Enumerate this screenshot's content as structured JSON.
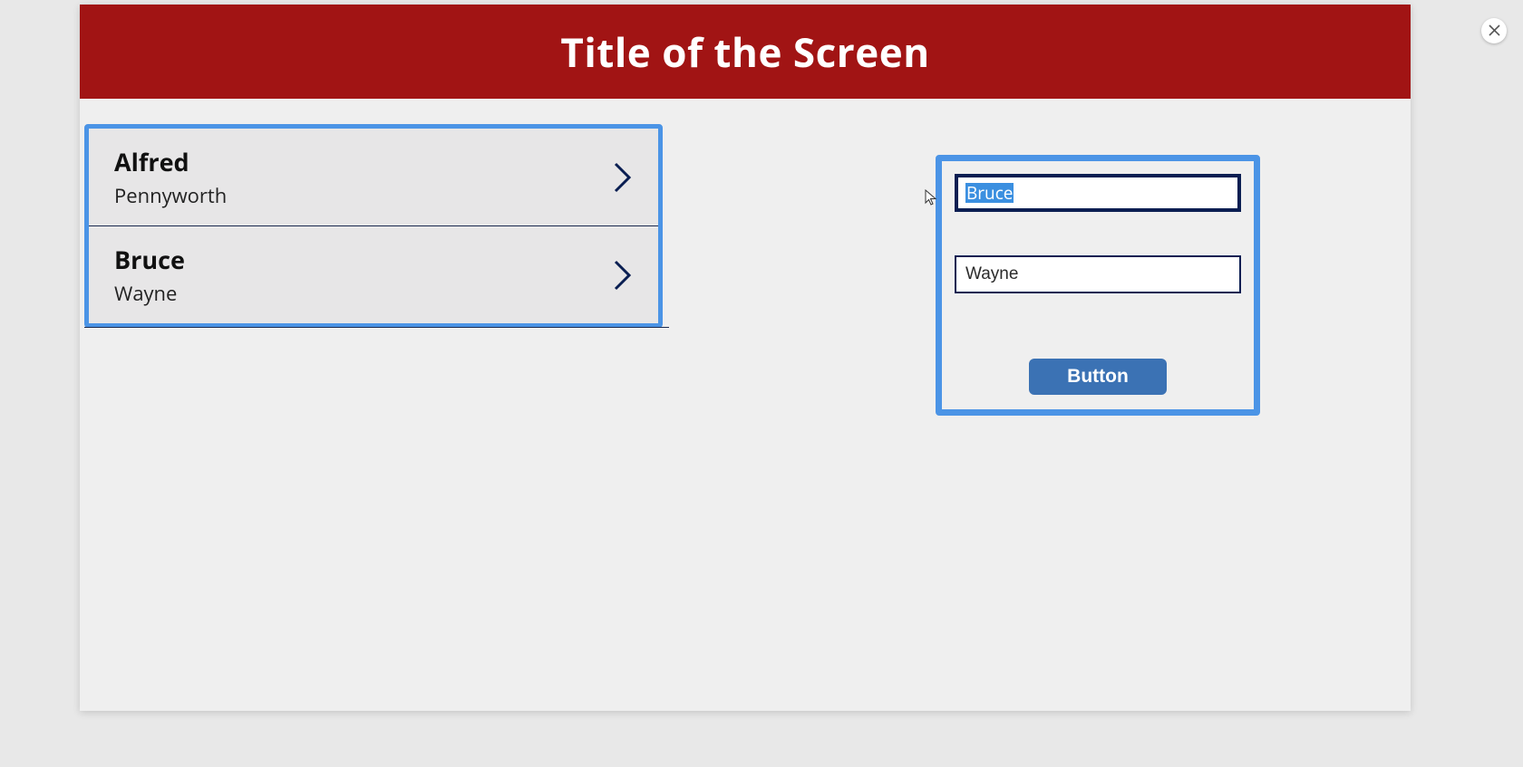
{
  "header": {
    "title": "Title of the Screen"
  },
  "list": {
    "items": [
      {
        "primary": "Alfred",
        "secondary": "Pennyworth"
      },
      {
        "primary": "Bruce",
        "secondary": "Wayne"
      }
    ]
  },
  "form": {
    "first_name_value": "Bruce",
    "last_name_value": "Wayne",
    "button_label": "Button"
  },
  "icons": {
    "chevron": "chevron-right-icon",
    "close": "close-icon",
    "cursor": "cursor-icon"
  }
}
